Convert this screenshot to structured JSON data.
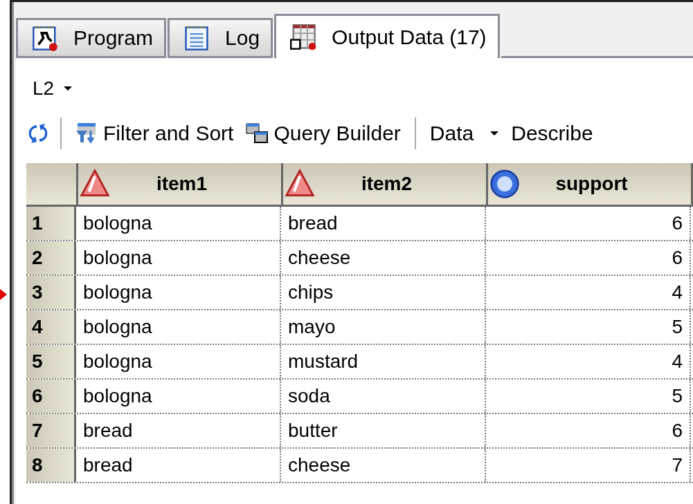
{
  "tabs": [
    {
      "label": "Program",
      "selected": false
    },
    {
      "label": "Log",
      "selected": false
    },
    {
      "label": "Output Data (17)",
      "selected": true
    }
  ],
  "dataset_selector": {
    "value": "L2"
  },
  "toolbar": [
    {
      "kind": "refresh"
    },
    {
      "kind": "separator"
    },
    {
      "kind": "filter",
      "label": "Filter and Sort"
    },
    {
      "kind": "query",
      "label": "Query Builder"
    },
    {
      "kind": "separator"
    },
    {
      "kind": "menu",
      "label": "Data"
    },
    {
      "kind": "text",
      "label": "Describe"
    }
  ],
  "table": {
    "columns": [
      {
        "name": "item1",
        "kind": "character"
      },
      {
        "name": "item2",
        "kind": "character"
      },
      {
        "name": "support",
        "kind": "numeric"
      }
    ],
    "rows": [
      {
        "n": "1",
        "cells": [
          "bologna",
          "bread",
          "6"
        ]
      },
      {
        "n": "2",
        "cells": [
          "bologna",
          "cheese",
          "6"
        ]
      },
      {
        "n": "3",
        "cells": [
          "bologna",
          "chips",
          "4"
        ]
      },
      {
        "n": "4",
        "cells": [
          "bologna",
          "mayo",
          "5"
        ]
      },
      {
        "n": "5",
        "cells": [
          "bologna",
          "mustard",
          "4"
        ]
      },
      {
        "n": "6",
        "cells": [
          "bologna",
          "soda",
          "5"
        ]
      },
      {
        "n": "7",
        "cells": [
          "bread",
          "butter",
          "6"
        ]
      },
      {
        "n": "8",
        "cells": [
          "bread",
          "cheese",
          "7"
        ]
      }
    ]
  }
}
